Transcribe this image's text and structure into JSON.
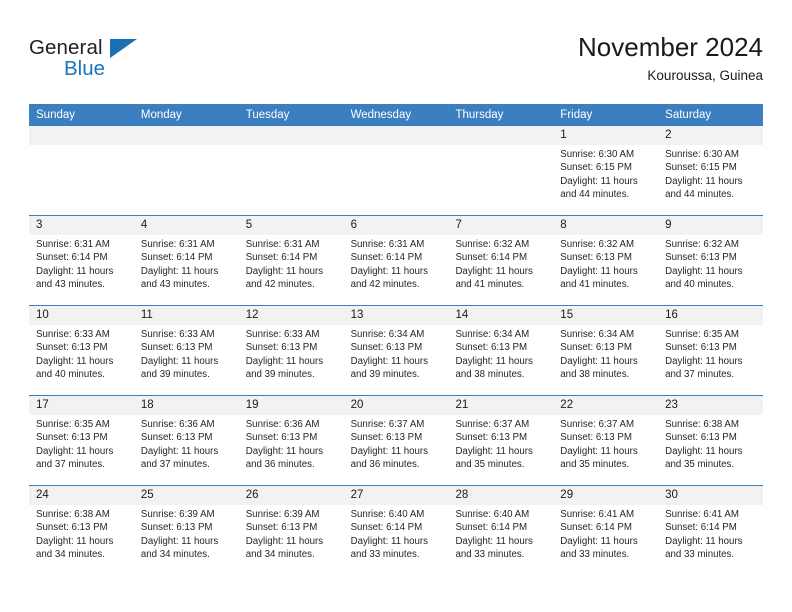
{
  "brand": {
    "word_one": "General",
    "word_two": "Blue",
    "triangle_icon": "triangle-icon"
  },
  "header": {
    "title": "November 2024",
    "subtitle": "Kouroussa, Guinea"
  },
  "colors": {
    "header_blue": "#3c7fc1",
    "daynum_band": "#f2f2f2",
    "brand_blue": "#1b75bb",
    "text": "#1a1a1a"
  },
  "weekdays": [
    "Sunday",
    "Monday",
    "Tuesday",
    "Wednesday",
    "Thursday",
    "Friday",
    "Saturday"
  ],
  "weeks": [
    {
      "days": [
        {
          "num": "",
          "empty": true,
          "l1": "",
          "l2": "",
          "l3": "",
          "l4": ""
        },
        {
          "num": "",
          "empty": true,
          "l1": "",
          "l2": "",
          "l3": "",
          "l4": ""
        },
        {
          "num": "",
          "empty": true,
          "l1": "",
          "l2": "",
          "l3": "",
          "l4": ""
        },
        {
          "num": "",
          "empty": true,
          "l1": "",
          "l2": "",
          "l3": "",
          "l4": ""
        },
        {
          "num": "",
          "empty": true,
          "l1": "",
          "l2": "",
          "l3": "",
          "l4": ""
        },
        {
          "num": "1",
          "empty": false,
          "l1": "Sunrise: 6:30 AM",
          "l2": "Sunset: 6:15 PM",
          "l3": "Daylight: 11 hours",
          "l4": "and 44 minutes."
        },
        {
          "num": "2",
          "empty": false,
          "l1": "Sunrise: 6:30 AM",
          "l2": "Sunset: 6:15 PM",
          "l3": "Daylight: 11 hours",
          "l4": "and 44 minutes."
        }
      ]
    },
    {
      "days": [
        {
          "num": "3",
          "empty": false,
          "l1": "Sunrise: 6:31 AM",
          "l2": "Sunset: 6:14 PM",
          "l3": "Daylight: 11 hours",
          "l4": "and 43 minutes."
        },
        {
          "num": "4",
          "empty": false,
          "l1": "Sunrise: 6:31 AM",
          "l2": "Sunset: 6:14 PM",
          "l3": "Daylight: 11 hours",
          "l4": "and 43 minutes."
        },
        {
          "num": "5",
          "empty": false,
          "l1": "Sunrise: 6:31 AM",
          "l2": "Sunset: 6:14 PM",
          "l3": "Daylight: 11 hours",
          "l4": "and 42 minutes."
        },
        {
          "num": "6",
          "empty": false,
          "l1": "Sunrise: 6:31 AM",
          "l2": "Sunset: 6:14 PM",
          "l3": "Daylight: 11 hours",
          "l4": "and 42 minutes."
        },
        {
          "num": "7",
          "empty": false,
          "l1": "Sunrise: 6:32 AM",
          "l2": "Sunset: 6:14 PM",
          "l3": "Daylight: 11 hours",
          "l4": "and 41 minutes."
        },
        {
          "num": "8",
          "empty": false,
          "l1": "Sunrise: 6:32 AM",
          "l2": "Sunset: 6:13 PM",
          "l3": "Daylight: 11 hours",
          "l4": "and 41 minutes."
        },
        {
          "num": "9",
          "empty": false,
          "l1": "Sunrise: 6:32 AM",
          "l2": "Sunset: 6:13 PM",
          "l3": "Daylight: 11 hours",
          "l4": "and 40 minutes."
        }
      ]
    },
    {
      "days": [
        {
          "num": "10",
          "empty": false,
          "l1": "Sunrise: 6:33 AM",
          "l2": "Sunset: 6:13 PM",
          "l3": "Daylight: 11 hours",
          "l4": "and 40 minutes."
        },
        {
          "num": "11",
          "empty": false,
          "l1": "Sunrise: 6:33 AM",
          "l2": "Sunset: 6:13 PM",
          "l3": "Daylight: 11 hours",
          "l4": "and 39 minutes."
        },
        {
          "num": "12",
          "empty": false,
          "l1": "Sunrise: 6:33 AM",
          "l2": "Sunset: 6:13 PM",
          "l3": "Daylight: 11 hours",
          "l4": "and 39 minutes."
        },
        {
          "num": "13",
          "empty": false,
          "l1": "Sunrise: 6:34 AM",
          "l2": "Sunset: 6:13 PM",
          "l3": "Daylight: 11 hours",
          "l4": "and 39 minutes."
        },
        {
          "num": "14",
          "empty": false,
          "l1": "Sunrise: 6:34 AM",
          "l2": "Sunset: 6:13 PM",
          "l3": "Daylight: 11 hours",
          "l4": "and 38 minutes."
        },
        {
          "num": "15",
          "empty": false,
          "l1": "Sunrise: 6:34 AM",
          "l2": "Sunset: 6:13 PM",
          "l3": "Daylight: 11 hours",
          "l4": "and 38 minutes."
        },
        {
          "num": "16",
          "empty": false,
          "l1": "Sunrise: 6:35 AM",
          "l2": "Sunset: 6:13 PM",
          "l3": "Daylight: 11 hours",
          "l4": "and 37 minutes."
        }
      ]
    },
    {
      "days": [
        {
          "num": "17",
          "empty": false,
          "l1": "Sunrise: 6:35 AM",
          "l2": "Sunset: 6:13 PM",
          "l3": "Daylight: 11 hours",
          "l4": "and 37 minutes."
        },
        {
          "num": "18",
          "empty": false,
          "l1": "Sunrise: 6:36 AM",
          "l2": "Sunset: 6:13 PM",
          "l3": "Daylight: 11 hours",
          "l4": "and 37 minutes."
        },
        {
          "num": "19",
          "empty": false,
          "l1": "Sunrise: 6:36 AM",
          "l2": "Sunset: 6:13 PM",
          "l3": "Daylight: 11 hours",
          "l4": "and 36 minutes."
        },
        {
          "num": "20",
          "empty": false,
          "l1": "Sunrise: 6:37 AM",
          "l2": "Sunset: 6:13 PM",
          "l3": "Daylight: 11 hours",
          "l4": "and 36 minutes."
        },
        {
          "num": "21",
          "empty": false,
          "l1": "Sunrise: 6:37 AM",
          "l2": "Sunset: 6:13 PM",
          "l3": "Daylight: 11 hours",
          "l4": "and 35 minutes."
        },
        {
          "num": "22",
          "empty": false,
          "l1": "Sunrise: 6:37 AM",
          "l2": "Sunset: 6:13 PM",
          "l3": "Daylight: 11 hours",
          "l4": "and 35 minutes."
        },
        {
          "num": "23",
          "empty": false,
          "l1": "Sunrise: 6:38 AM",
          "l2": "Sunset: 6:13 PM",
          "l3": "Daylight: 11 hours",
          "l4": "and 35 minutes."
        }
      ]
    },
    {
      "days": [
        {
          "num": "24",
          "empty": false,
          "l1": "Sunrise: 6:38 AM",
          "l2": "Sunset: 6:13 PM",
          "l3": "Daylight: 11 hours",
          "l4": "and 34 minutes."
        },
        {
          "num": "25",
          "empty": false,
          "l1": "Sunrise: 6:39 AM",
          "l2": "Sunset: 6:13 PM",
          "l3": "Daylight: 11 hours",
          "l4": "and 34 minutes."
        },
        {
          "num": "26",
          "empty": false,
          "l1": "Sunrise: 6:39 AM",
          "l2": "Sunset: 6:13 PM",
          "l3": "Daylight: 11 hours",
          "l4": "and 34 minutes."
        },
        {
          "num": "27",
          "empty": false,
          "l1": "Sunrise: 6:40 AM",
          "l2": "Sunset: 6:14 PM",
          "l3": "Daylight: 11 hours",
          "l4": "and 33 minutes."
        },
        {
          "num": "28",
          "empty": false,
          "l1": "Sunrise: 6:40 AM",
          "l2": "Sunset: 6:14 PM",
          "l3": "Daylight: 11 hours",
          "l4": "and 33 minutes."
        },
        {
          "num": "29",
          "empty": false,
          "l1": "Sunrise: 6:41 AM",
          "l2": "Sunset: 6:14 PM",
          "l3": "Daylight: 11 hours",
          "l4": "and 33 minutes."
        },
        {
          "num": "30",
          "empty": false,
          "l1": "Sunrise: 6:41 AM",
          "l2": "Sunset: 6:14 PM",
          "l3": "Daylight: 11 hours",
          "l4": "and 33 minutes."
        }
      ]
    }
  ]
}
